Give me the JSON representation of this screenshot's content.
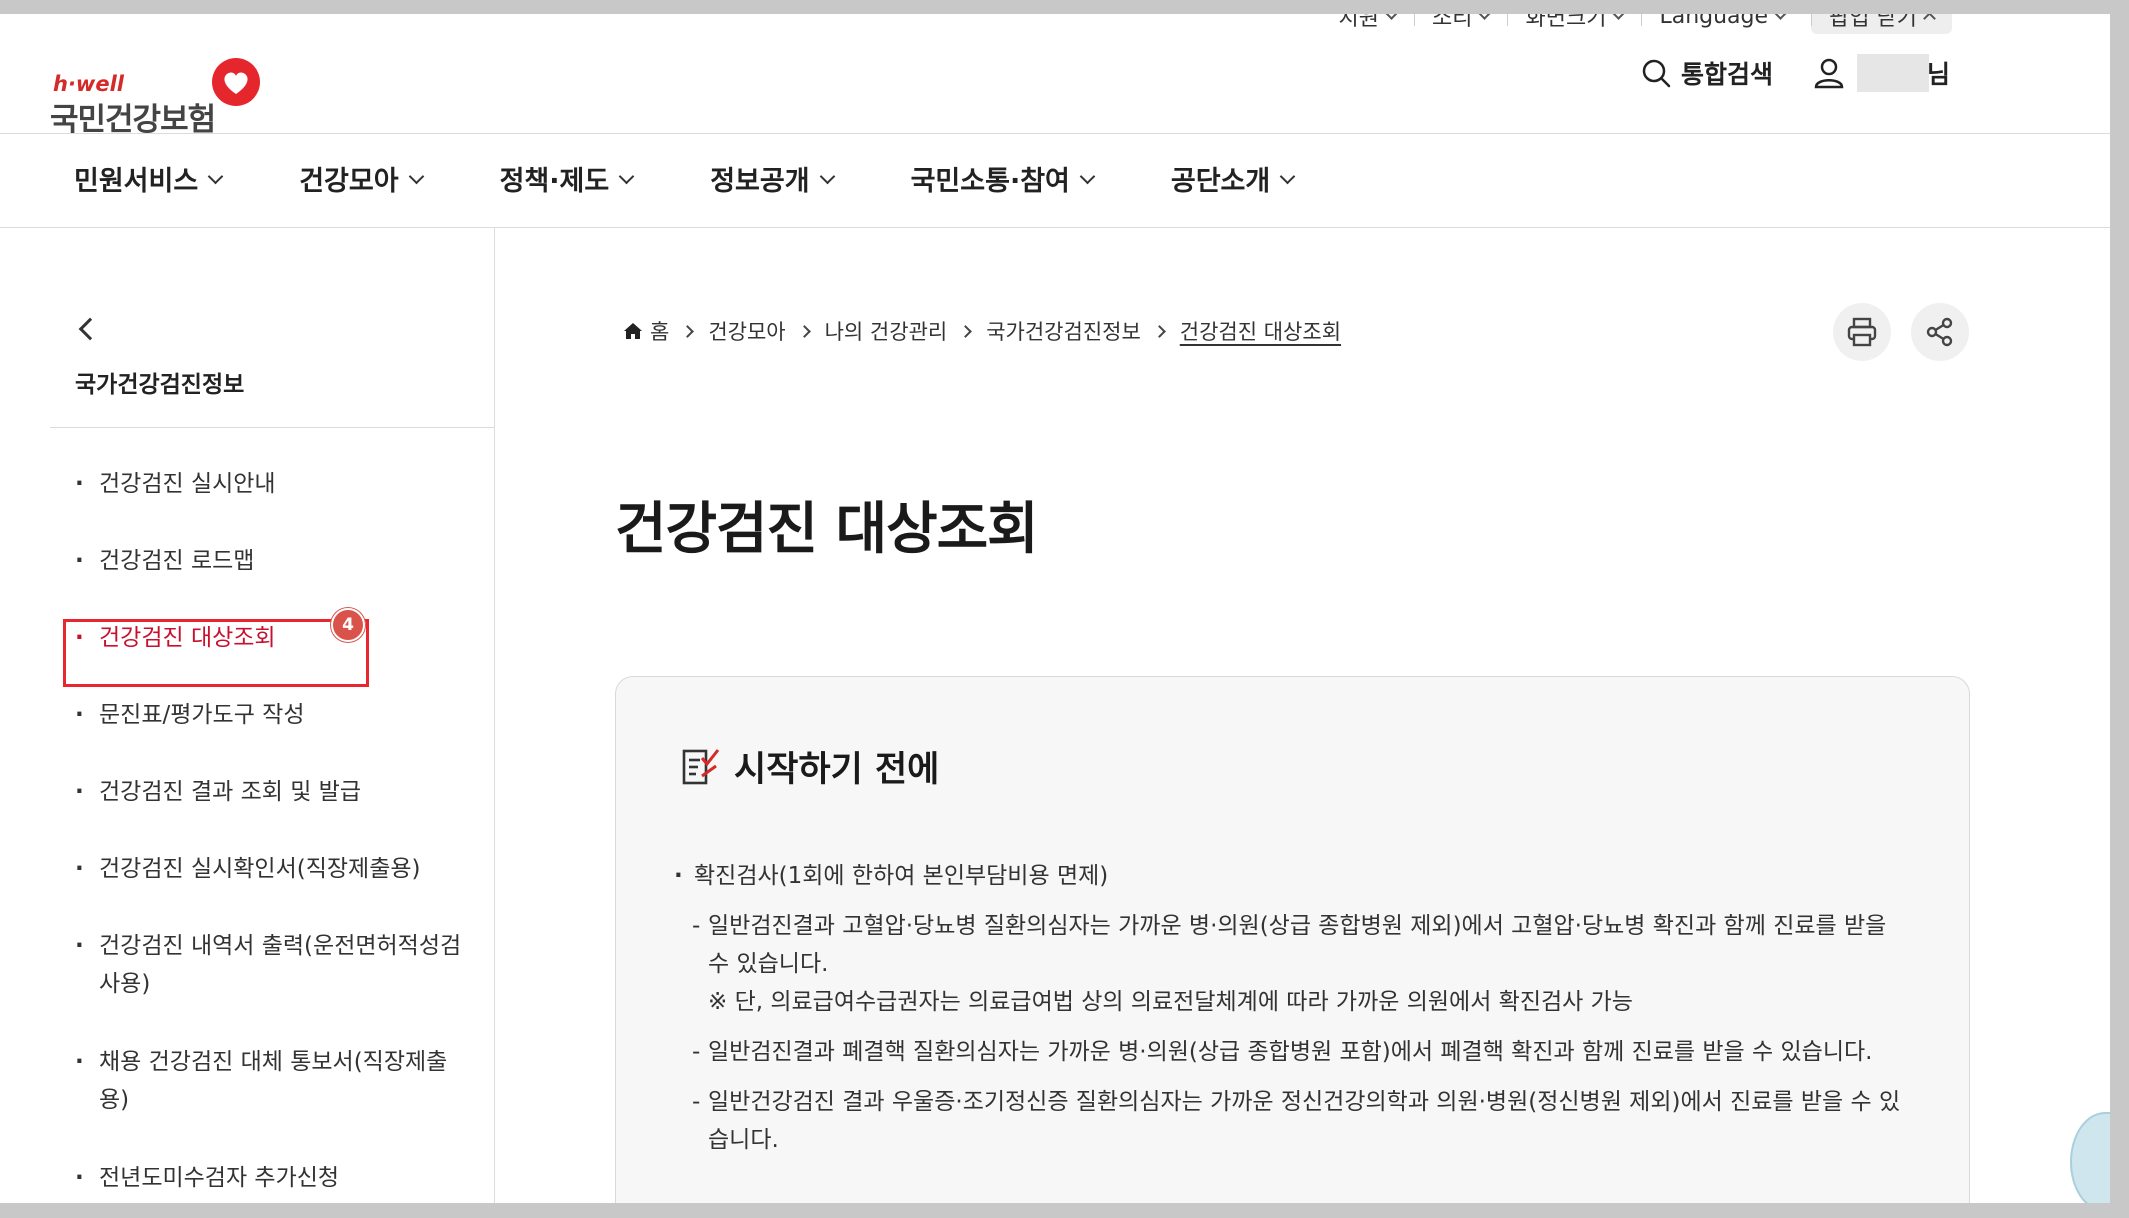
{
  "util_bar": {
    "items": [
      "지원",
      "소리",
      "화면크기",
      "Language"
    ],
    "popup_label": "팝업 닫기"
  },
  "header": {
    "logo_sub": "h·well",
    "logo_name": "국민건강보험",
    "search_label": "통합검색",
    "user_suffix": "님"
  },
  "gnb": {
    "items": [
      "민원서비스",
      "건강모아",
      "정책·제도",
      "정보공개",
      "국민소통·참여",
      "공단소개"
    ]
  },
  "sidebar": {
    "title": "국가건강검진정보",
    "items": [
      "건강검진 실시안내",
      "건강검진 로드맵",
      "건강검진 대상조회",
      "문진표/평가도구 작성",
      "건강검진 결과 조회 및 발급",
      "건강검진 실시확인서(직장제출용)",
      "건강검진 내역서 출력(운전면허적성검사용)",
      "채용 건강검진 대체 통보서(직장제출용)",
      "전년도미수검자 추가신청"
    ],
    "badge": "4"
  },
  "breadcrumb": [
    "홈",
    "건강모아",
    "나의 건강관리",
    "국가건강검진정보",
    "건강검진 대상조회"
  ],
  "page_title": "건강검진 대상조회",
  "notice": {
    "title": "시작하기 전에",
    "bullet": "확진검사(1회에 한하여 본인부담비용 면제)",
    "items": [
      "일반검진결과 고혈압·당뇨병 질환의심자는 가까운 병·의원(상급 종합병원 제외)에서 고혈압·당뇨병 확진과 함께 진료를 받을 수 있습니다.",
      "일반검진결과 폐결핵 질환의심자는 가까운 병·의원(상급 종합병원 포함)에서 폐결핵 확진과 함께 진료를 받을 수 있습니다.",
      "일반건강검진 결과 우울증·조기정신증 질환의심자는 가까운 정신건강의학과 의원·병원(정신병원 제외)에서 진료를 받을 수 있습니다."
    ],
    "note": "※ 단, 의료급여수급권자는 의료급여법 상의 의료전달체계에 따라 가까운 의원에서 확진검사 가능"
  },
  "colors": {
    "brand_red": "#d42a2a",
    "active_red": "#c8102e",
    "highlight_box": "#e8262e"
  }
}
